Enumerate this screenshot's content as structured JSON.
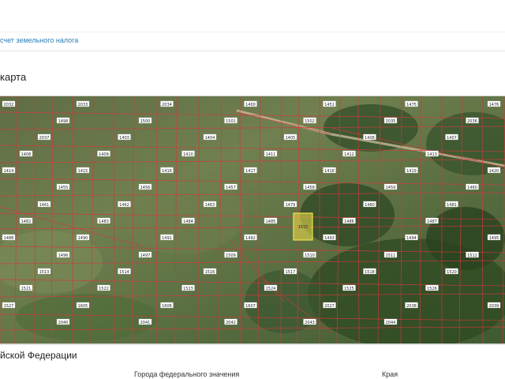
{
  "breadcrumb": {
    "link_label": "счет земельного налога"
  },
  "section": {
    "title": "карта"
  },
  "map": {
    "highlight_color": "#f2e34a",
    "boundary_color": "#d23a3a",
    "parcels": [
      "2032",
      "2033",
      "2034",
      "1400",
      "1451",
      "1475",
      "1476",
      "1498",
      "1500",
      "1501",
      "1502",
      "2035",
      "2036",
      "2037",
      "1403",
      "1404",
      "1405",
      "1406",
      "1407",
      "1408",
      "1409",
      "1410",
      "1411",
      "1412",
      "1413",
      "1414",
      "1415",
      "1416",
      "1417",
      "1418",
      "1419",
      "1420",
      "1455",
      "1456",
      "1457",
      "1458",
      "1459",
      "1460",
      "1461",
      "1462",
      "1463",
      "1479",
      "1480",
      "1481",
      "1482",
      "1483",
      "1484",
      "1485",
      "1486",
      "1487",
      "1488",
      "1490",
      "1491",
      "1492",
      "1493",
      "1494",
      "1495",
      "1496",
      "1497",
      "1509",
      "1510",
      "1511",
      "1512",
      "1513",
      "1514",
      "1516",
      "1517",
      "1518",
      "1520",
      "1521",
      "1522",
      "1523",
      "1524",
      "1525",
      "1526",
      "1527",
      "1605",
      "1606",
      "1607",
      "2027",
      "2038",
      "2039",
      "2040",
      "2041",
      "2042",
      "2043",
      "2044"
    ],
    "highlighted_parcel": "1515"
  },
  "footer": {
    "title": "йской Федерации",
    "col1": "Города федерального значения",
    "col2": "Края"
  }
}
